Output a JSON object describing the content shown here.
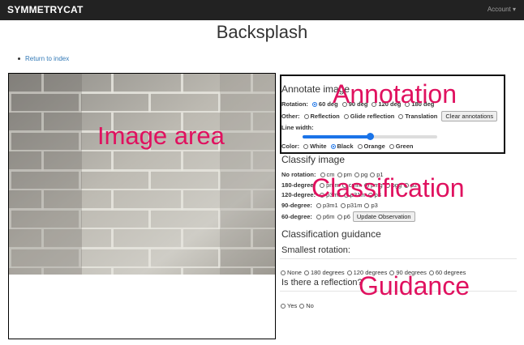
{
  "navbar": {
    "brand": "SYMMETRYCAT",
    "account": "Account ▾"
  },
  "page": {
    "title": "Backsplash",
    "back_link": "Return to index"
  },
  "overlays": {
    "image_area": "Image area",
    "annotation": "Annotation",
    "classification": "Classification",
    "guidance": "Guidance"
  },
  "annotate": {
    "title": "Annotate image",
    "rotation_label": "Rotation:",
    "rotation_options": [
      "60 deg",
      "90 deg",
      "120 deg",
      "180 deg"
    ],
    "rotation_selected": "60 deg",
    "other_label": "Other:",
    "other_options": [
      "Reflection",
      "Glide reflection",
      "Translation"
    ],
    "clear_button": "Clear annotations",
    "line_width_label": "Line width:",
    "line_width_fraction": 0.5,
    "color_label": "Color:",
    "color_options": [
      "White",
      "Black",
      "Orange",
      "Green"
    ],
    "color_selected": "Black"
  },
  "classify": {
    "title": "Classify image",
    "rows": [
      {
        "label": "No rotation:",
        "options": [
          "cm",
          "pm",
          "pg",
          "p1"
        ]
      },
      {
        "label": "180-degree:",
        "options": [
          "pmm",
          "cmm",
          "pmg",
          "pgg",
          "p2"
        ]
      },
      {
        "label": "120-degree:",
        "options": [
          "p3m1",
          "p31m",
          "p3"
        ]
      },
      {
        "label": "90-degree:",
        "options": [
          "p3m1",
          "p31m",
          "p3"
        ]
      },
      {
        "label": "60-degree:",
        "options": [
          "p6m",
          "p6"
        ]
      }
    ],
    "update_button": "Update Observation"
  },
  "guidance": {
    "title": "Classification guidance",
    "q1": "Smallest rotation:",
    "q1_options": [
      "None",
      "180 degrees",
      "120 degrees",
      "90 degrees",
      "60 degrees"
    ],
    "q2": "Is there a reflection?",
    "q2_options": [
      "Yes",
      "No"
    ]
  }
}
